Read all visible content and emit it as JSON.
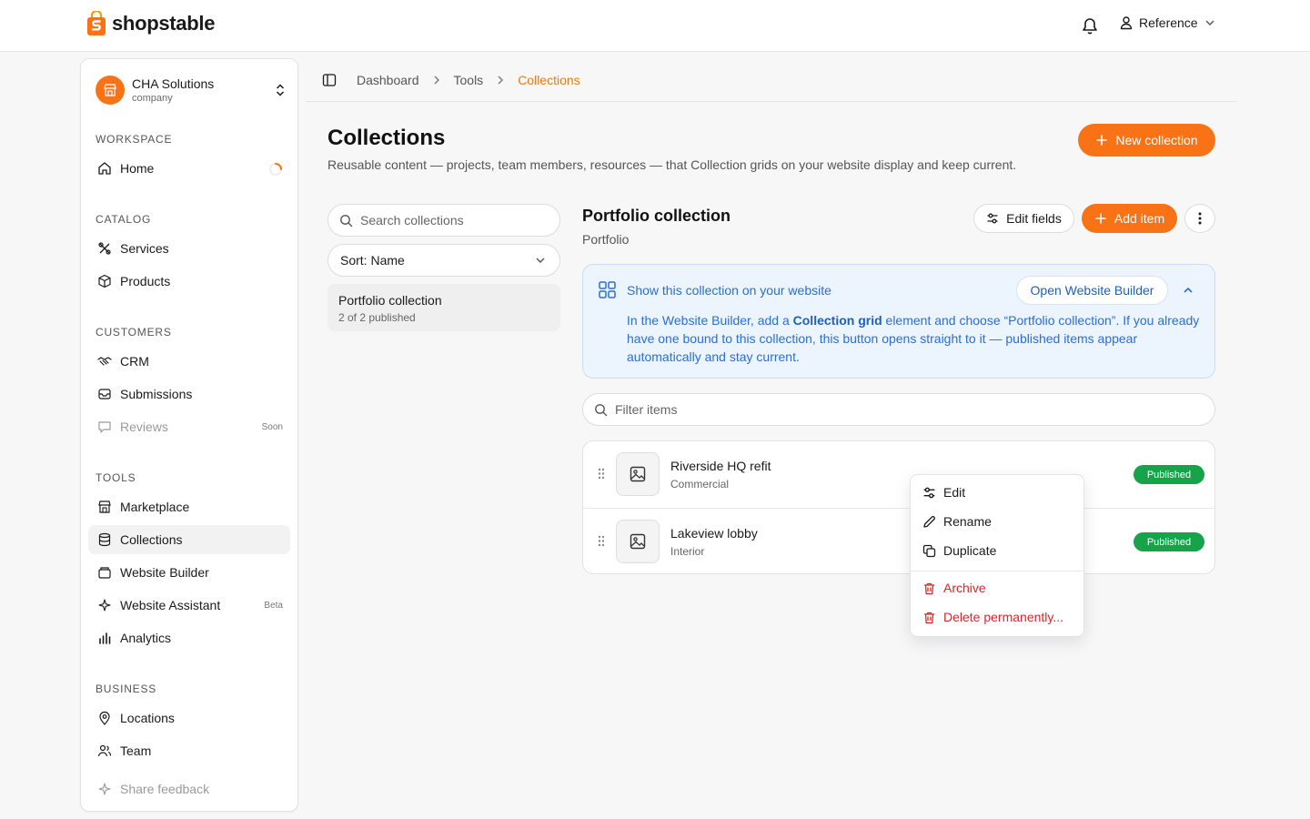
{
  "app": {
    "brand": "shopstable",
    "accent": "#f97316"
  },
  "topbar": {
    "user_label": "Reference"
  },
  "sidebar": {
    "company": {
      "name": "CHA Solutions",
      "type": "company"
    },
    "sections": {
      "workspace": "WORKSPACE",
      "catalog": "CATALOG",
      "customers": "CUSTOMERS",
      "tools": "TOOLS",
      "business": "BUSINESS"
    },
    "items": {
      "home": "Home",
      "services": "Services",
      "products": "Products",
      "crm": "CRM",
      "submissions": "Submissions",
      "reviews": "Reviews",
      "reviews_tag": "Soon",
      "marketplace": "Marketplace",
      "collections": "Collections",
      "website_builder": "Website Builder",
      "website_assistant": "Website Assistant",
      "website_assistant_tag": "Beta",
      "analytics": "Analytics",
      "locations": "Locations",
      "team": "Team",
      "share_feedback": "Share feedback"
    }
  },
  "breadcrumb": {
    "items": [
      "Dashboard",
      "Tools",
      "Collections"
    ]
  },
  "page": {
    "title": "Collections",
    "description": "Reusable content — projects, team members, resources — that Collection grids on your website display and keep current.",
    "new_collection_label": "New collection"
  },
  "collections_list": {
    "search_placeholder": "Search collections",
    "sort_label": "Sort: Name",
    "items": [
      {
        "name": "Portfolio collection",
        "status": "2 of 2 published"
      }
    ]
  },
  "detail": {
    "title": "Portfolio collection",
    "subtitle": "Portfolio",
    "edit_fields_label": "Edit fields",
    "add_item_label": "Add item",
    "info": {
      "title": "Show this collection on your website",
      "button": "Open Website Builder",
      "text_before": "In the Website Builder, add a ",
      "text_bold": "Collection grid",
      "text_after": " element and choose “Portfolio collection”. If you already have one bound to this collection, this button opens straight to it — published items appear automatically and stay current."
    },
    "filter_placeholder": "Filter items",
    "items": [
      {
        "name": "Riverside HQ refit",
        "category": "Commercial",
        "status": "Published"
      },
      {
        "name": "Lakeview lobby",
        "category": "Interior",
        "status": "Published"
      }
    ]
  },
  "context_menu": {
    "edit": "Edit",
    "rename": "Rename",
    "duplicate": "Duplicate",
    "archive": "Archive",
    "delete": "Delete permanently..."
  },
  "colors": {
    "published": "#16a34a",
    "danger": "#dc2626",
    "info": "#2b6fd0"
  }
}
